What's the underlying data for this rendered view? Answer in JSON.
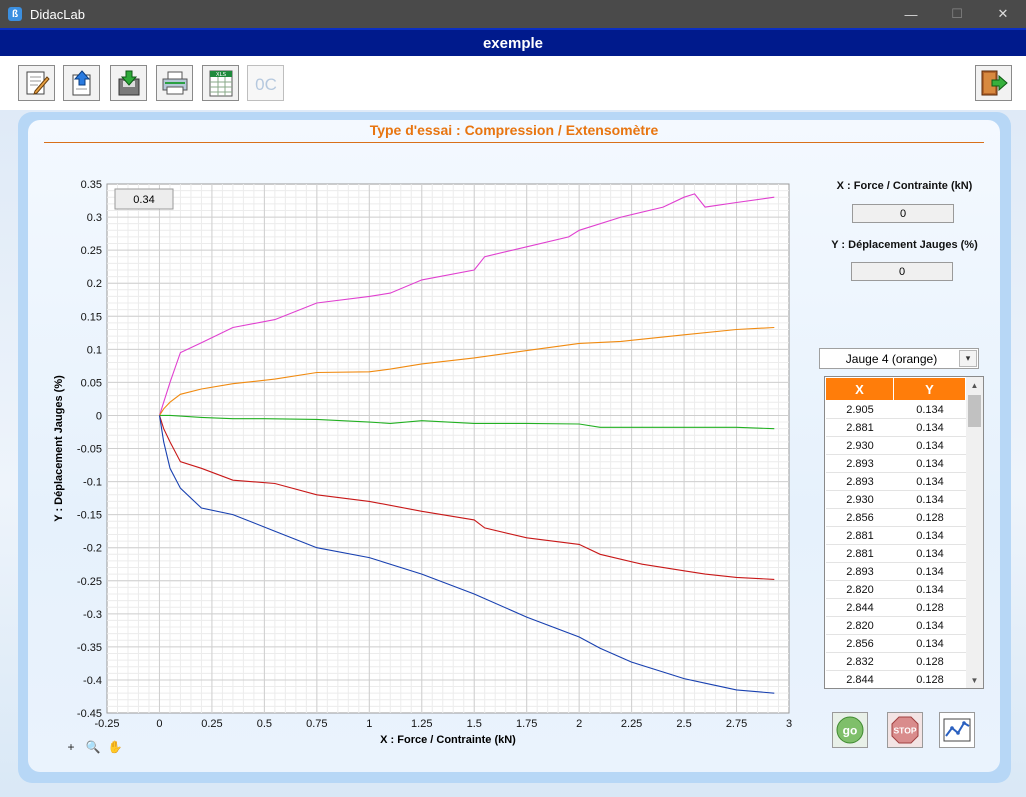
{
  "window": {
    "app_title": "DidacLab",
    "icon_letter": "ß",
    "minimize": "—",
    "maximize": "☐",
    "close": "✕"
  },
  "document": {
    "title": "exemple"
  },
  "toolbar": {
    "xls_label": "XLS",
    "oc_label": "0C",
    "buttons": [
      {
        "name": "new-document-button",
        "icon": "pencil-document-icon",
        "enabled": true
      },
      {
        "name": "open-button",
        "icon": "upload-document-icon",
        "enabled": true
      },
      {
        "name": "save-button",
        "icon": "download-document-icon",
        "enabled": true
      },
      {
        "name": "print-button",
        "icon": "printer-icon",
        "enabled": true
      },
      {
        "name": "export-xls-button",
        "icon": "spreadsheet-icon",
        "enabled": true
      },
      {
        "name": "oc-button",
        "icon": "oc-icon",
        "enabled": false
      },
      {
        "name": "exit-button",
        "icon": "exit-door-icon",
        "enabled": true
      }
    ]
  },
  "panel": {
    "title": "Type d'essai : Compression / Extensomètre"
  },
  "readout": {
    "cursor_value": "0.34"
  },
  "right": {
    "x_label": "X : Force / Contrainte (kN)",
    "x_value": "0",
    "y_label": "Y : Déplacement Jauges (%)",
    "y_value": "0",
    "gauge_selected": "Jauge 4 (orange)",
    "gauge_arrow": "▾",
    "table": {
      "headers": [
        "X",
        "Y"
      ],
      "rows": [
        [
          "2.905",
          "0.134"
        ],
        [
          "2.881",
          "0.134"
        ],
        [
          "2.930",
          "0.134"
        ],
        [
          "2.893",
          "0.134"
        ],
        [
          "2.893",
          "0.134"
        ],
        [
          "2.930",
          "0.134"
        ],
        [
          "2.856",
          "0.128"
        ],
        [
          "2.881",
          "0.134"
        ],
        [
          "2.881",
          "0.134"
        ],
        [
          "2.893",
          "0.134"
        ],
        [
          "2.820",
          "0.134"
        ],
        [
          "2.844",
          "0.128"
        ],
        [
          "2.820",
          "0.134"
        ],
        [
          "2.856",
          "0.134"
        ],
        [
          "2.832",
          "0.128"
        ],
        [
          "2.844",
          "0.128"
        ]
      ],
      "scroll_up": "▲",
      "scroll_down": "▼"
    }
  },
  "bottom_buttons": {
    "go_label": "go",
    "stop_label": "STOP"
  },
  "zoom_tools": [
    "+",
    "🔍",
    "✋"
  ],
  "colors": {
    "accent_orange": "#e87510",
    "header_blue": "#001a8c",
    "series_magenta": "#e040d0",
    "series_orange": "#f08a10",
    "series_green": "#22b022",
    "series_red": "#c81818",
    "series_blue": "#1840b0"
  },
  "chart_data": {
    "type": "line",
    "title": "",
    "xlabel": "X : Force / Contrainte (kN)",
    "ylabel": "Y : Déplacement Jauges (%)",
    "xlim": [
      -0.25,
      3
    ],
    "ylim": [
      -0.45,
      0.35
    ],
    "x_ticks": [
      "-0.25",
      "0",
      "0.25",
      "0.5",
      "0.75",
      "1",
      "1.25",
      "1.5",
      "1.75",
      "2",
      "2.25",
      "2.5",
      "2.75",
      "3"
    ],
    "y_ticks": [
      "0.35",
      "0.3",
      "0.25",
      "0.2",
      "0.15",
      "0.1",
      "0.05",
      "0",
      "-0.05",
      "-0.1",
      "-0.15",
      "-0.2",
      "-0.25",
      "-0.3",
      "-0.35",
      "-0.4",
      "-0.45"
    ],
    "grid": true,
    "series": [
      {
        "color": "#e040d0",
        "x": [
          0,
          0.02,
          0.05,
          0.1,
          0.2,
          0.35,
          0.55,
          0.75,
          1.0,
          1.1,
          1.25,
          1.5,
          1.55,
          1.75,
          1.95,
          2.0,
          2.2,
          2.4,
          2.5,
          2.55,
          2.6,
          2.75,
          2.93
        ],
        "y": [
          0.0,
          0.02,
          0.05,
          0.095,
          0.11,
          0.133,
          0.145,
          0.17,
          0.18,
          0.185,
          0.205,
          0.22,
          0.24,
          0.255,
          0.27,
          0.28,
          0.3,
          0.315,
          0.33,
          0.335,
          0.315,
          0.322,
          0.33
        ]
      },
      {
        "color": "#f08a10",
        "x": [
          0,
          0.02,
          0.05,
          0.1,
          0.2,
          0.35,
          0.55,
          0.75,
          1.0,
          1.1,
          1.25,
          1.5,
          1.75,
          2.0,
          2.2,
          2.5,
          2.75,
          2.93
        ],
        "y": [
          0.0,
          0.01,
          0.02,
          0.032,
          0.04,
          0.048,
          0.055,
          0.065,
          0.066,
          0.07,
          0.078,
          0.087,
          0.098,
          0.109,
          0.112,
          0.122,
          0.13,
          0.133
        ]
      },
      {
        "color": "#22b022",
        "x": [
          0,
          0.05,
          0.1,
          0.2,
          0.35,
          0.5,
          0.75,
          1.0,
          1.1,
          1.25,
          1.5,
          1.75,
          2.0,
          2.1,
          2.3,
          2.5,
          2.75,
          2.93
        ],
        "y": [
          0.0,
          0.0,
          -0.001,
          -0.003,
          -0.005,
          -0.005,
          -0.006,
          -0.01,
          -0.012,
          -0.008,
          -0.012,
          -0.012,
          -0.013,
          -0.018,
          -0.018,
          -0.018,
          -0.018,
          -0.02
        ]
      },
      {
        "color": "#c81818",
        "x": [
          0,
          0.02,
          0.05,
          0.1,
          0.2,
          0.35,
          0.55,
          0.75,
          1.0,
          1.25,
          1.5,
          1.55,
          1.75,
          2.0,
          2.1,
          2.3,
          2.5,
          2.6,
          2.75,
          2.93
        ],
        "y": [
          0.0,
          -0.02,
          -0.04,
          -0.07,
          -0.08,
          -0.098,
          -0.103,
          -0.12,
          -0.13,
          -0.145,
          -0.158,
          -0.17,
          -0.185,
          -0.195,
          -0.21,
          -0.225,
          -0.235,
          -0.24,
          -0.245,
          -0.248
        ]
      },
      {
        "color": "#1840b0",
        "x": [
          0,
          0.02,
          0.05,
          0.1,
          0.2,
          0.35,
          0.55,
          0.75,
          1.0,
          1.25,
          1.5,
          1.75,
          2.0,
          2.1,
          2.25,
          2.4,
          2.5,
          2.6,
          2.75,
          2.93
        ],
        "y": [
          0.0,
          -0.04,
          -0.08,
          -0.11,
          -0.14,
          -0.15,
          -0.175,
          -0.2,
          -0.215,
          -0.24,
          -0.27,
          -0.305,
          -0.335,
          -0.352,
          -0.373,
          -0.388,
          -0.398,
          -0.405,
          -0.415,
          -0.42
        ]
      }
    ]
  }
}
